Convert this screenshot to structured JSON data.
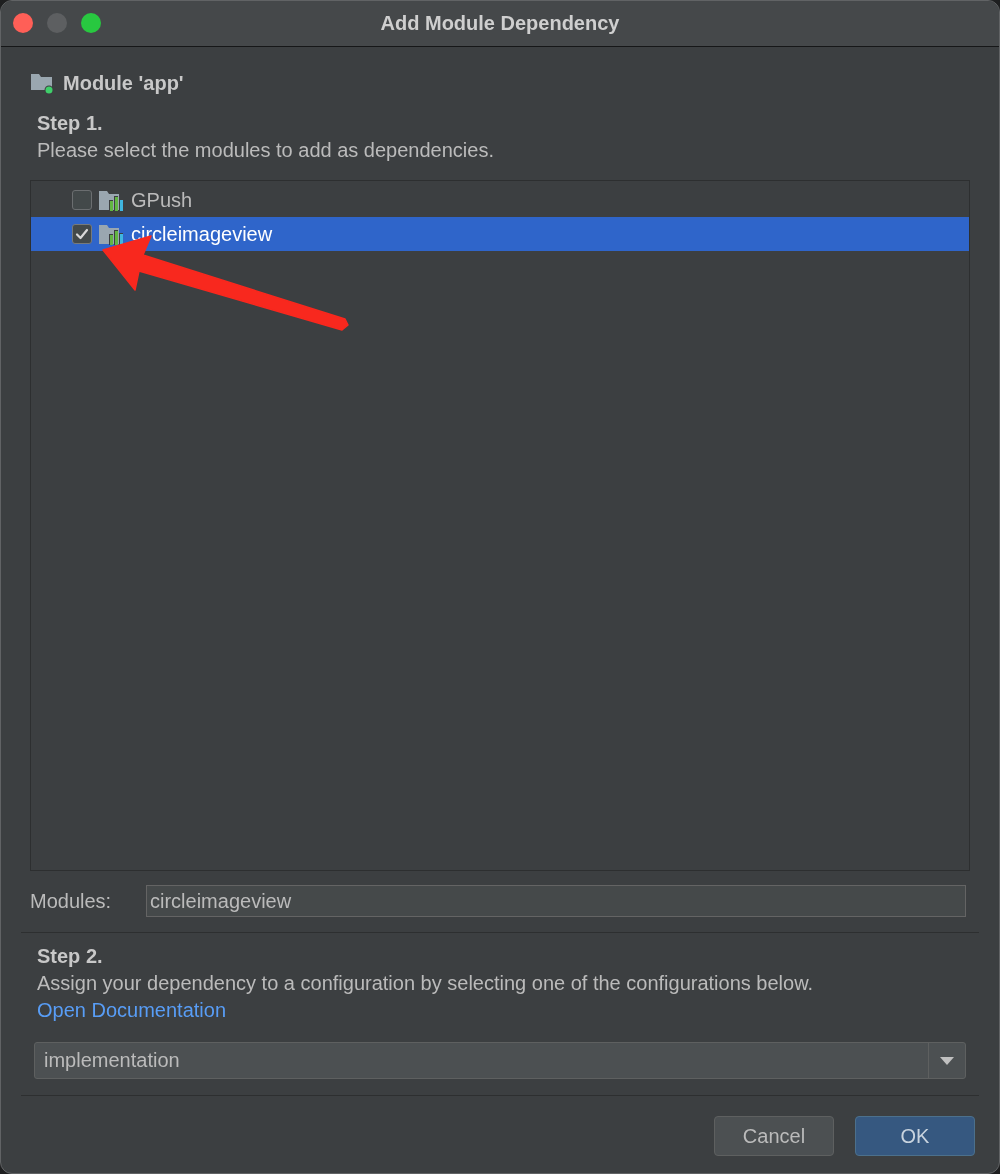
{
  "window": {
    "title": "Add Module Dependency",
    "controls": [
      {
        "kind": "close",
        "disabled": false
      },
      {
        "kind": "minimize",
        "disabled": true
      },
      {
        "kind": "zoom",
        "disabled": false
      }
    ]
  },
  "module": {
    "label": "Module 'app'"
  },
  "step1": {
    "heading": "Step 1.",
    "description": "Please select the modules to add as dependencies."
  },
  "modules_list": [
    {
      "name": "GPush",
      "checked": false,
      "selected": false
    },
    {
      "name": "circleimageview",
      "checked": true,
      "selected": true
    }
  ],
  "modules_field": {
    "label": "Modules:",
    "value": "circleimageview"
  },
  "step2": {
    "heading": "Step 2.",
    "description": "Assign your dependency to a configuration by selecting one of the configurations below.",
    "link": "Open Documentation"
  },
  "configuration": {
    "value": "implementation"
  },
  "buttons": [
    {
      "label": "Cancel",
      "kind": "default"
    },
    {
      "label": "OK",
      "kind": "primary"
    }
  ]
}
